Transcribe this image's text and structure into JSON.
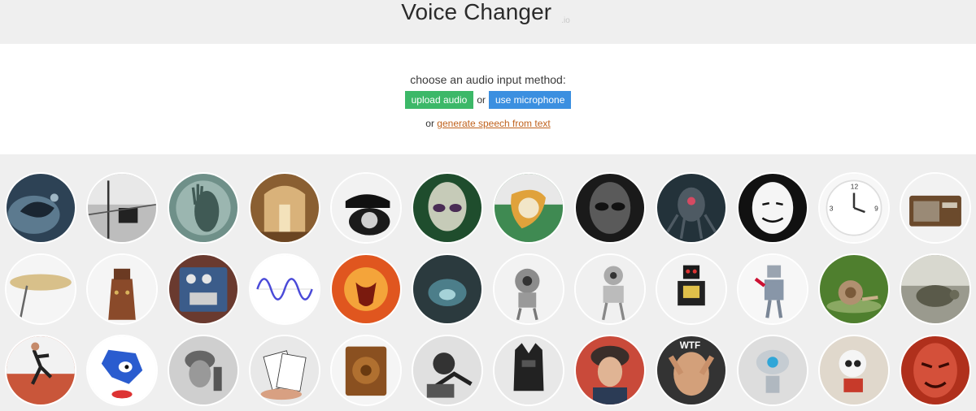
{
  "header": {
    "title": "Voice Changer",
    "suffix": ".io"
  },
  "input_panel": {
    "prompt": "choose an audio input method:",
    "upload_label": "upload audio",
    "or_text": "or",
    "mic_label": "use microphone",
    "tts_or": "or",
    "tts_link": "generate speech from text"
  },
  "voices": [
    "monster",
    "radio-tower",
    "ghost",
    "cathedral",
    "telephone",
    "alien",
    "melting-clock",
    "dark-alien",
    "robot-spider",
    "anonymous",
    "reversed-clock",
    "radio",
    "cymbal",
    "dalek",
    "pedal",
    "sine-wave",
    "fire-demon",
    "cave",
    "robot-1",
    "robot-2",
    "toy-robot",
    "lego-robot",
    "snail",
    "turtle",
    "sprinter",
    "sonic",
    "soldier",
    "cards",
    "speaker",
    "phonograph",
    "dark-lord",
    "russian",
    "wtf",
    "robot-3",
    "robot-4",
    "red-demon"
  ]
}
